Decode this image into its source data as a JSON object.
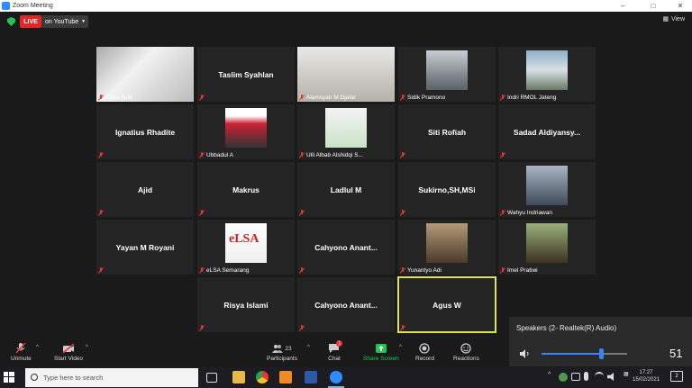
{
  "window": {
    "title": "Zoom Meeting"
  },
  "topbar": {
    "live_label": "LIVE",
    "stream_label": "on YouTube",
    "view_label": "View"
  },
  "tiles": [
    {
      "label": "Faiza N.M",
      "video": true
    },
    {
      "name": "Taslim Syahlan"
    },
    {
      "label": "Alamsyah M Djafar",
      "video": true
    },
    {
      "label": "Sidik Pramono",
      "video": true
    },
    {
      "label": "Indri RMOL Jateng",
      "video": true
    },
    {
      "name": "Ignatius Rhadite"
    },
    {
      "label": "Ubbadul A",
      "video": true
    },
    {
      "label": "Ulil Albab Alshidqi S...",
      "video": true
    },
    {
      "name": "Siti Rofiah"
    },
    {
      "name": "Sadad  Aldiyansy..."
    },
    {
      "name": "Ajid"
    },
    {
      "name": "Makrus"
    },
    {
      "name": "Ladlul M"
    },
    {
      "name": "Sukirno,SH,MSi"
    },
    {
      "label": "Wahyu Indriawan",
      "video": true
    },
    {
      "name": "Yayan M Royani"
    },
    {
      "label": "eLSA Semarang",
      "video": true,
      "logo": "eLSA"
    },
    {
      "name": "Cahyono  Anant..."
    },
    {
      "label": "Yunantyo Adi",
      "video": true
    },
    {
      "label": "Imel Pratiwi",
      "video": true
    },
    {
      "name": "Risya Islami"
    },
    {
      "name": "Cahyono  Anant..."
    },
    {
      "name": "Agus W",
      "active": true
    }
  ],
  "toolbar": {
    "unmute": "Unmute",
    "start_video": "Start Video",
    "participants": "Participants",
    "participants_count": "23",
    "chat": "Chat",
    "chat_badge": "1",
    "share": "Share Screen",
    "record": "Record",
    "reactions": "Reactions"
  },
  "speaker_popup": {
    "title": "Speakers (2- Realtek(R) Audio)",
    "volume": "51",
    "level": 0.69
  },
  "taskbar": {
    "search_placeholder": "Type here to search",
    "time": "17:27",
    "date": "15/02/2021",
    "notif_count": "2"
  },
  "colors": {
    "live": "#e02828",
    "share_green": "#23c552",
    "active_border": "#dde24f",
    "accent": "#3b82f6"
  }
}
